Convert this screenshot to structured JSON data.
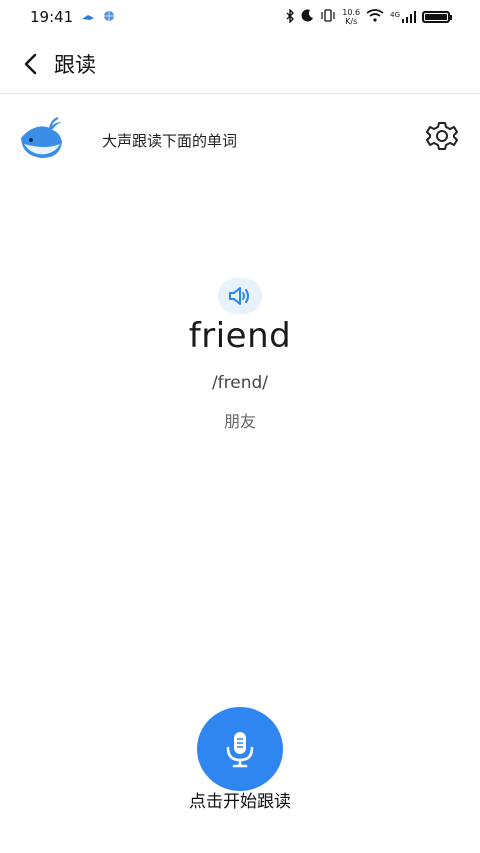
{
  "status_bar": {
    "time": "19:41",
    "net_speed_value": "10.6",
    "net_speed_unit": "K/s",
    "network": "4G"
  },
  "header": {
    "title": "跟读"
  },
  "prompt": {
    "text": "大声跟读下面的单词"
  },
  "word_card": {
    "word": "friend",
    "phonetic": "/frend/",
    "meaning": "朋友"
  },
  "record": {
    "label": "点击开始跟读"
  },
  "colors": {
    "accent": "#2f86f0",
    "speaker_bg": "#e7f2fd"
  }
}
